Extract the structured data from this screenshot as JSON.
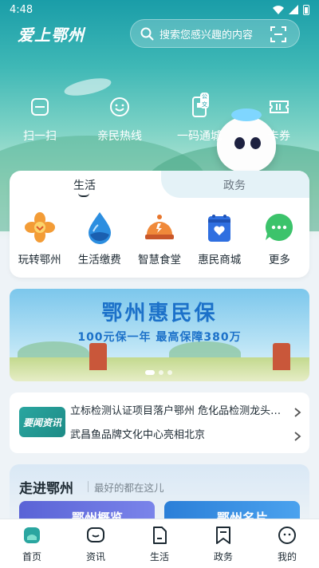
{
  "status_bar": {
    "time": "4:48"
  },
  "header": {
    "logo": "爱上鄂州",
    "search": {
      "placeholder": "搜索您感兴趣的内容"
    }
  },
  "quick_actions": [
    {
      "label": "扫一扫",
      "icon": "scan-frame-icon"
    },
    {
      "label": "亲民热线",
      "icon": "smile-icon"
    },
    {
      "label": "一码通城",
      "icon": "phone-code-icon",
      "badge": "公交"
    },
    {
      "label": "卡券",
      "icon": "ticket-icon"
    }
  ],
  "service_card": {
    "tabs": [
      {
        "label": "生活",
        "active": true
      },
      {
        "label": "政务",
        "active": false
      }
    ],
    "items": [
      {
        "label": "玩转鄂州",
        "icon": "flower-icon",
        "color": "#f39c36"
      },
      {
        "label": "生活缴费",
        "icon": "water-drop-icon",
        "color": "#2c8ee0"
      },
      {
        "label": "智慧食堂",
        "icon": "food-cloche-icon",
        "color": "#e8762c"
      },
      {
        "label": "惠民商城",
        "icon": "shopping-bag-icon",
        "color": "#2f6fe0"
      },
      {
        "label": "更多",
        "icon": "more-chat-icon",
        "color": "#3cc36b"
      }
    ]
  },
  "banner": {
    "title": "鄂州惠民保",
    "subtitle": "100元保一年   最高保障380万",
    "carousel_count": 3,
    "active_index": 0
  },
  "news": {
    "logo": "要闻资讯",
    "items": [
      "立标检测认证项目落户鄂州 危化品检测龙头…",
      "武昌鱼品牌文化中心亮相北京"
    ]
  },
  "explore": {
    "title": "走进鄂州",
    "subtitle": "最好的都在这儿",
    "cards": [
      "鄂州概览",
      "鄂州名片"
    ]
  },
  "bottom_nav": [
    {
      "label": "首页",
      "icon": "home-icon",
      "active": true
    },
    {
      "label": "资讯",
      "icon": "news-chat-icon",
      "active": false
    },
    {
      "label": "生活",
      "icon": "document-icon",
      "active": false
    },
    {
      "label": "政务",
      "icon": "bookmark-icon",
      "active": false
    },
    {
      "label": "我的",
      "icon": "profile-face-icon",
      "active": false
    }
  ],
  "colors": {
    "primary": "#1a9da8",
    "banner_text": "#1c71c9",
    "accent_green": "#2aa6a0"
  }
}
